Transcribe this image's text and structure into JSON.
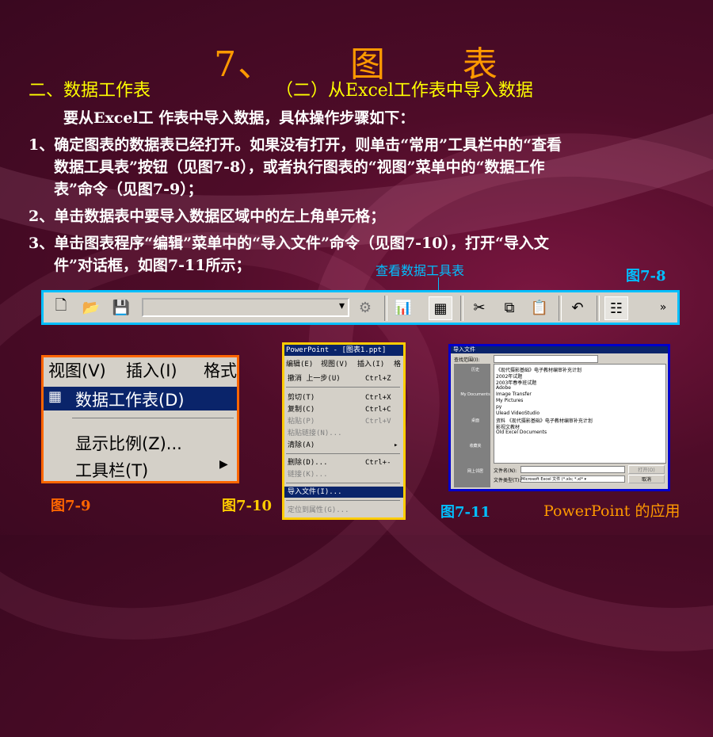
{
  "slide": {
    "title": "7、      图      表",
    "section_left": "二、数据工作表",
    "section_right": "（二）从Excel工作表中导入数据",
    "intro": "要从Excel工 作表中导入数据，具体操作步骤如下：",
    "step1": [
      "1、确定图表的数据表已经打开。如果没有打开，则单击“常用”工具栏中的“查看",
      "数据工具表”按钮（见图7-8），或者执行图表的“视图”菜单中的“数据工作",
      "表”命令（见图7-9）；"
    ],
    "step2": "2、单击数据表中要导入数据区域中的左上角单元格；",
    "step3": [
      "3、单击图表程序“编辑”菜单中的“导入文件”命令（见图7-10），打开“导入文",
      "件”对话框，如图7-11所示；"
    ],
    "callout": "查看数据工具表",
    "fig8": "图7-8",
    "fig9": "图7-9",
    "fig10": "图7-10",
    "fig11": "图7-11",
    "footer": "PowerPoint 的应用",
    "colors": {
      "title": "#ff9900",
      "section": "#ffff00",
      "callout": "#00bfff",
      "fig": "#00bfff",
      "footer": "#ff9900"
    }
  },
  "toolbar": {
    "icons": [
      "new-icon",
      "open-icon",
      "save-icon",
      "combo-dropdown",
      "format-icon",
      "import-chart-icon",
      "view-datasheet-icon",
      "cut-icon",
      "copy-icon",
      "paste-icon",
      "undo-icon",
      "grid-icon",
      "more-icon"
    ]
  },
  "menu9": {
    "bar": [
      "视图(V)",
      "插入(I)",
      "格式"
    ],
    "items": [
      "数据工作表(D)",
      "显示比例(Z)...",
      "工具栏(T)"
    ]
  },
  "menu10": {
    "title": "PowerPoint - [图表1.ppt]",
    "bar": [
      "编辑(E)",
      "视图(V)",
      "插入(I)",
      "格"
    ],
    "rows": [
      {
        "label": "撤消 上一步(U)",
        "key": "Ctrl+Z"
      },
      {
        "label": "剪切(T)",
        "key": "Ctrl+X"
      },
      {
        "label": "复制(C)",
        "key": "Ctrl+C"
      },
      {
        "label": "粘贴(P)",
        "key": "Ctrl+V"
      },
      {
        "label": "粘贴链接(N)...",
        "key": ""
      },
      {
        "label": "清除(A)",
        "key": ""
      },
      {
        "label": "删除(D)...",
        "key": "Ctrl+-"
      },
      {
        "label": "链接(K)...",
        "key": ""
      },
      {
        "label": "导入文件(I)...",
        "key": ""
      },
      {
        "label": "定位到属性(G)...",
        "key": ""
      }
    ]
  },
  "dialog11": {
    "title": "导入文件",
    "lookin_label": "查找范围(I):",
    "places": [
      "历史",
      "My Documents",
      "桌面",
      "收藏夹",
      "网上邻居"
    ],
    "files": [
      "《现代摄影基础》电子教材编审补充计划",
      "2002年试题",
      "2003年春季班试题",
      "Adobe",
      "Image Transfer",
      "My Pictures",
      "py",
      "Ulead VideoStudio",
      "资料 《现代摄影基础》电子教材编审补充计划",
      "影视文教材",
      "Old Excel Documents"
    ],
    "filename_label": "文件名(N):",
    "filetype_label": "文件类型(T):",
    "filetype_value": "Microsoft Excel 文件 (*.xls; *.xl* ▾",
    "open_label": "打开(O)",
    "cancel_label": "取消"
  }
}
